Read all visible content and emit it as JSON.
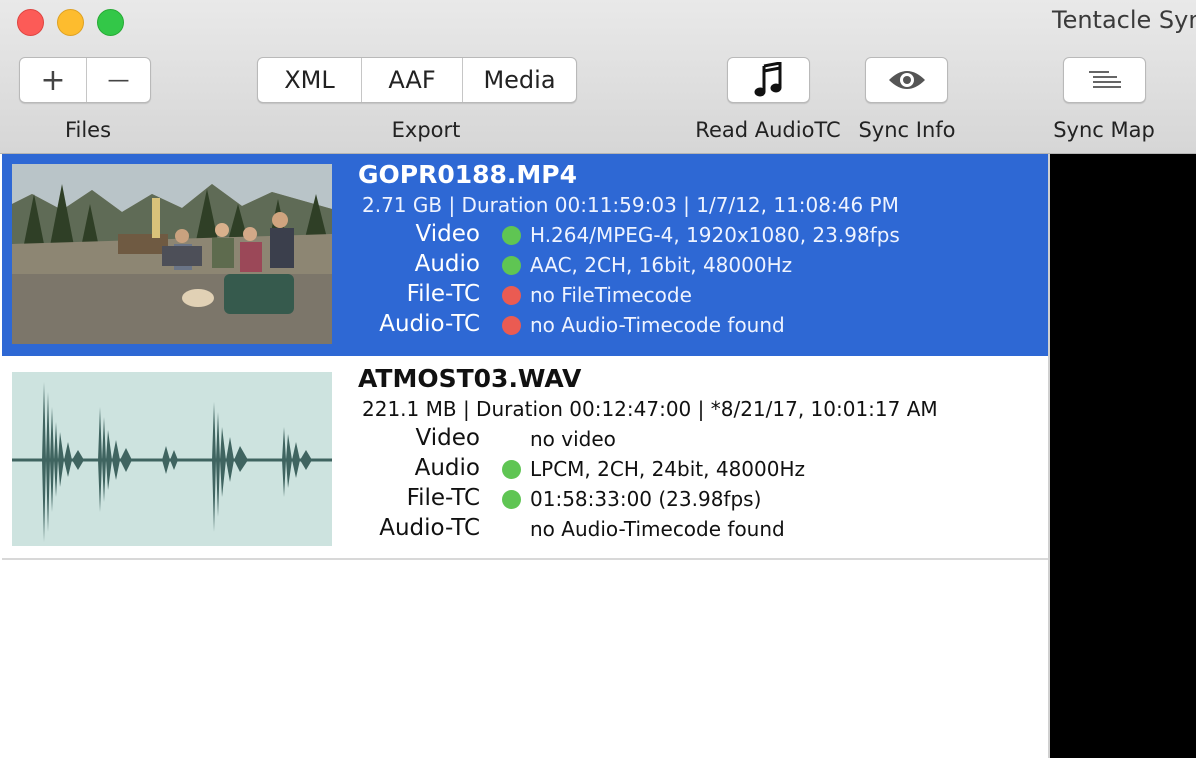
{
  "window": {
    "title": "Tentacle Syn"
  },
  "toolbar": {
    "files_label": "Files",
    "add_label": "+",
    "remove_label": "—",
    "export_label": "Export",
    "export_buttons": [
      "XML",
      "AAF",
      "Media"
    ],
    "read_audiotc_label": "Read AudioTC",
    "sync_info_label": "Sync Info",
    "sync_map_label": "Sync Map"
  },
  "files": [
    {
      "name": "GOPR0188.MP4",
      "meta": "2.71 GB | Duration 00:11:59:03 | 1/7/12, 11:08:46 PM",
      "video_label": "Video",
      "video": "H.264/MPEG-4, 1920x1080, 23.98fps",
      "video_status": "ok",
      "audio_label": "Audio",
      "audio": "AAC, 2CH, 16bit, 48000Hz",
      "audio_status": "ok",
      "filetc_label": "File-TC",
      "filetc": "no FileTimecode",
      "filetc_status": "missing",
      "audiotc_label": "Audio-TC",
      "audiotc": "no Audio-Timecode found",
      "audiotc_status": "missing"
    },
    {
      "name": "ATMOST03.WAV",
      "meta": "221.1 MB | Duration 00:12:47:00 | *8/21/17, 10:01:17 AM",
      "video_label": "Video",
      "video": "no video",
      "video_status": "none",
      "audio_label": "Audio",
      "audio": "LPCM, 2CH, 24bit, 48000Hz",
      "audio_status": "ok",
      "filetc_label": "File-TC",
      "filetc": "01:58:33:00 (23.98fps)",
      "filetc_status": "ok",
      "audiotc_label": "Audio-TC",
      "audiotc": "no Audio-Timecode found",
      "audiotc_status": "none"
    }
  ],
  "colors": {
    "selection": "#2e68d4",
    "status_ok": "#5fc553",
    "status_missing": "#ea5b52",
    "waveform_bg": "#cde3df",
    "waveform": "#3f6460"
  },
  "icons": {
    "read_audiotc": "music-note-icon",
    "sync_info": "eye-icon",
    "sync_map": "list-lines-icon"
  }
}
